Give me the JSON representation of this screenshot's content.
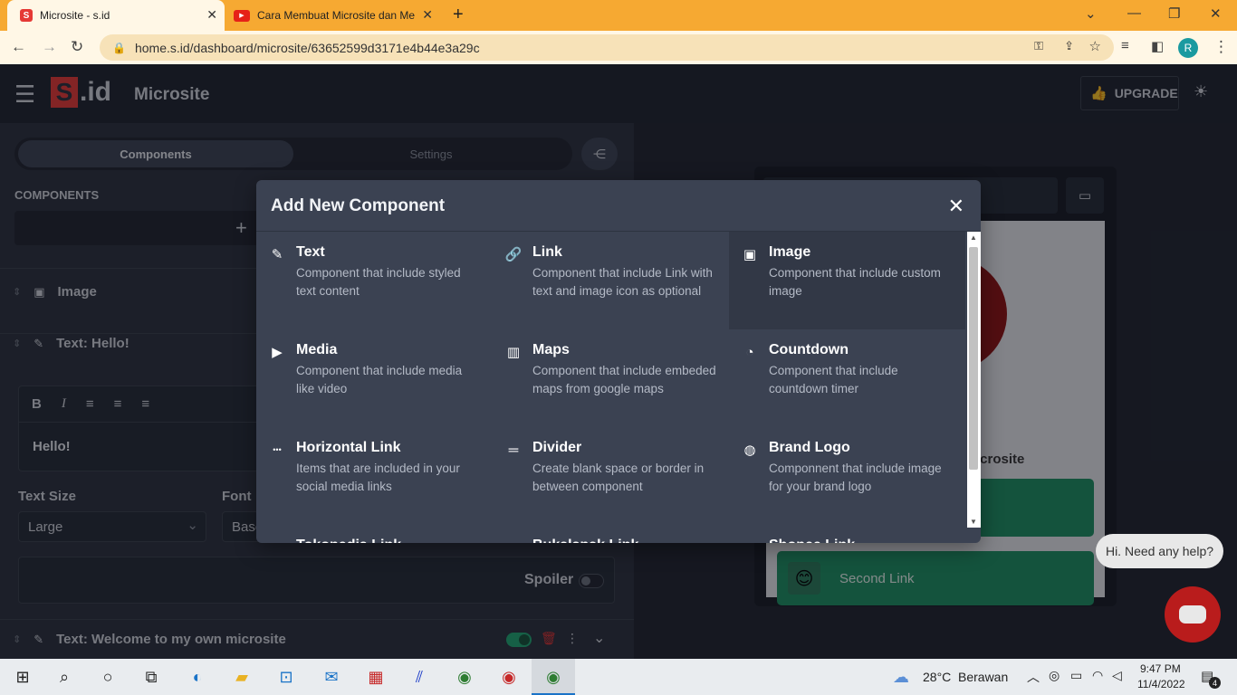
{
  "browser": {
    "tabs": [
      {
        "title": "Microsite - s.id",
        "favicon": "S",
        "active": true
      },
      {
        "title": "Cara Membuat Microsite dan Me",
        "favicon": "▶",
        "active": false
      }
    ],
    "url": "home.s.id/dashboard/microsite/63652599d3171e4b44e3a29c",
    "profile_initial": "R"
  },
  "app": {
    "logo_s": "S",
    "logo_id": ".id",
    "title": "Microsite",
    "upgrade_label": "UPGRADE"
  },
  "left": {
    "tabs": [
      "Components",
      "Settings"
    ],
    "section_title": "COMPONENTS",
    "add_symbol": "+",
    "items": [
      {
        "label": "Image"
      },
      {
        "label": "Text: Hello!"
      },
      {
        "label": "Text: Welcome to my own microsite"
      }
    ],
    "editor_text": "Hello!",
    "text_size_label": "Text Size",
    "text_size_value": "Large",
    "font_label": "Font",
    "font_value": "Base",
    "spoiler_label": "Spoiler"
  },
  "preview": {
    "partial_title": "icrosite",
    "second_link": "Second Link",
    "help_bubble": "Hi. Need any help?"
  },
  "modal": {
    "title": "Add New Component",
    "components": [
      {
        "name": "Text",
        "desc": "Component that include styled text content",
        "icon": "pencil-icon"
      },
      {
        "name": "Link",
        "desc": "Component that include Link with text and image icon as optional",
        "icon": "link-icon"
      },
      {
        "name": "Image",
        "desc": "Component that include custom image",
        "icon": "image-icon"
      },
      {
        "name": "Media",
        "desc": "Component that include media like video",
        "icon": "video-icon"
      },
      {
        "name": "Maps",
        "desc": "Component that include embeded maps from google maps",
        "icon": "map-icon"
      },
      {
        "name": "Countdown",
        "desc": "Component that include countdown timer",
        "icon": "clock-icon"
      },
      {
        "name": "Horizontal Link",
        "desc": "Items that are included in your social media links",
        "icon": "dots-icon"
      },
      {
        "name": "Divider",
        "desc": "Create blank space or border in between component",
        "icon": "divider-icon"
      },
      {
        "name": "Brand Logo",
        "desc": "Componnent that include image for your brand logo",
        "icon": "brand-icon"
      },
      {
        "name": "Tokopedia Link",
        "desc": "",
        "icon": "tokopedia-icon"
      },
      {
        "name": "Bukalapak Link",
        "desc": "",
        "icon": "bukalapak-icon"
      },
      {
        "name": "Shopee Link",
        "desc": "",
        "icon": "shopee-icon"
      }
    ]
  },
  "taskbar": {
    "temperature": "28°C",
    "weather": "Berawan",
    "time": "9:47 PM",
    "date": "11/4/2022",
    "notification_count": "4"
  }
}
